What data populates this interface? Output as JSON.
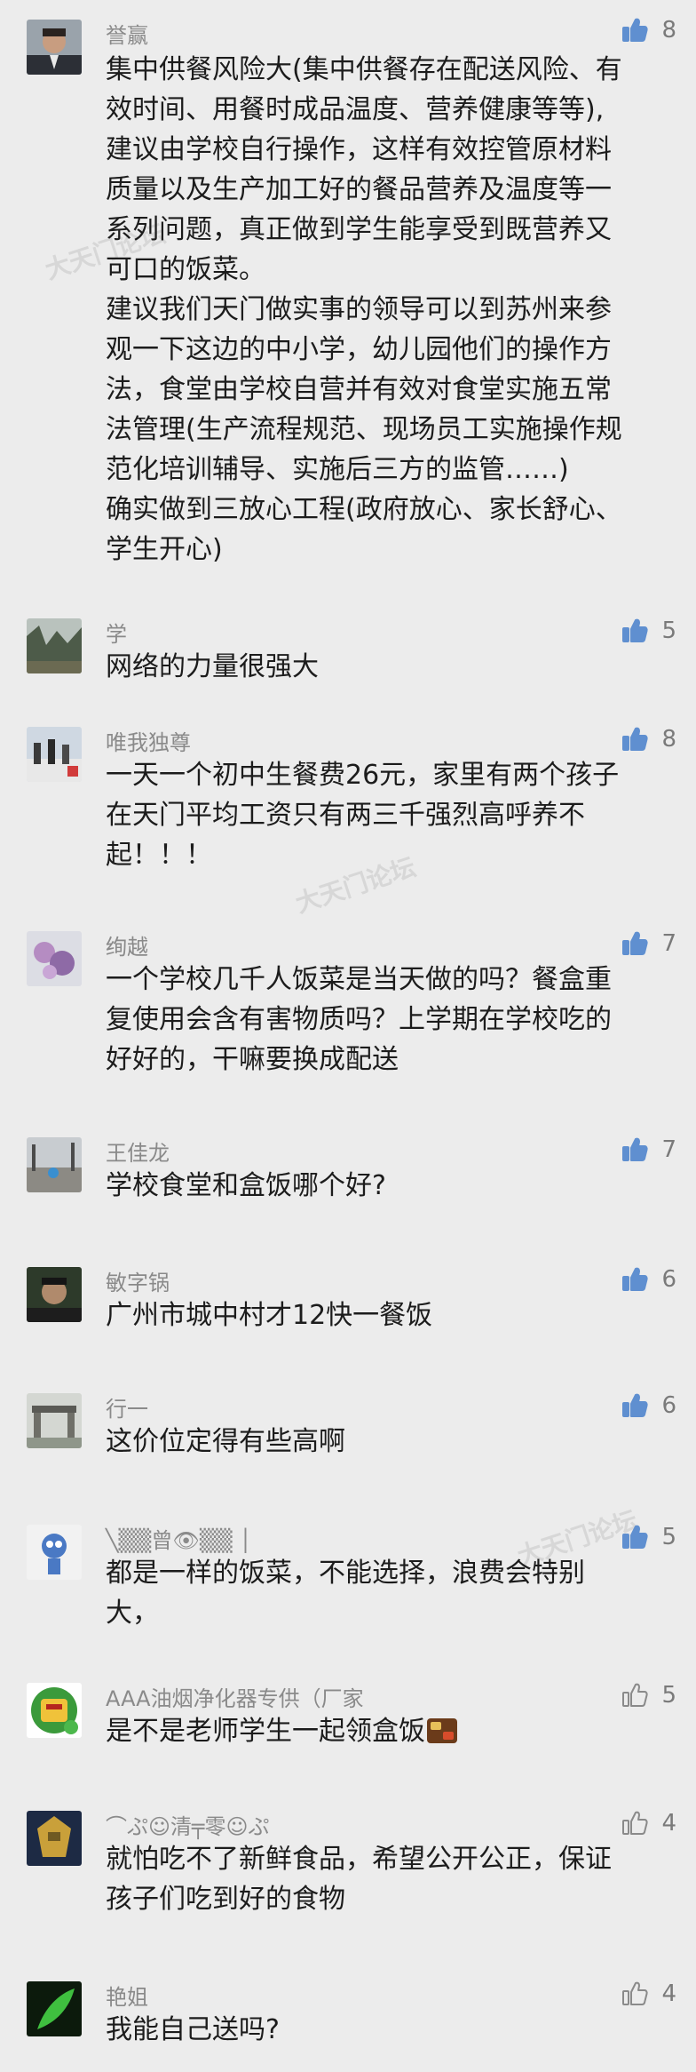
{
  "watermark": "大天门论坛",
  "comments": [
    {
      "user": "誉赢",
      "likes": "8",
      "liked": true,
      "lines": [
        "集中供餐风险大(集中供餐存在配送风险、有",
        "效时间、用餐时成品温度、营养健康等等),",
        "建议由学校自行操作，这样有效控管原材料",
        "质量以及生产加工好的餐品营养及温度等一",
        "系列问题，真正做到学生能享受到既营养又",
        "可口的饭菜。",
        "建议我们天门做实事的领导可以到苏州来参",
        "观一下这边的中小学，幼儿园他们的操作方",
        "法，食堂由学校自营并有效对食堂实施五常",
        "法管理(生产流程规范、现场员工实施操作规",
        "范化培训辅导、实施后三方的监管……)",
        "确实做到三放心工程(政府放心、家长舒心、",
        "学生开心)"
      ]
    },
    {
      "user": "学",
      "likes": "5",
      "liked": true,
      "lines": [
        "网络的力量很强大"
      ]
    },
    {
      "user": "唯我独尊",
      "likes": "8",
      "liked": true,
      "lines": [
        "一天一个初中生餐费26元，家里有两个孩子",
        "在天门平均工资只有两三千强烈高呼养不",
        "起！！！"
      ]
    },
    {
      "user": "绚越",
      "likes": "7",
      "liked": true,
      "lines": [
        "一个学校几千人饭菜是当天做的吗？餐盒重",
        "复使用会含有害物质吗？上学期在学校吃的",
        "好好的，干嘛要换成配送"
      ]
    },
    {
      "user": "王佳龙",
      "likes": "7",
      "liked": true,
      "lines": [
        "学校食堂和盒饭哪个好?"
      ]
    },
    {
      "user": "敏字锅",
      "likes": "6",
      "liked": true,
      "lines": [
        "广州市城中村才12快一餐饭"
      ]
    },
    {
      "user": "行一",
      "likes": "6",
      "liked": true,
      "lines": [
        "这价位定得有些高啊"
      ]
    },
    {
      "user": "╲▒▒曾👁▒▒ │",
      "likes": "5",
      "liked": true,
      "lines": [
        "都是一样的饭菜，不能选择，浪费会特别",
        "大，"
      ]
    },
    {
      "user": "AAA油烟净化器专供（厂家",
      "likes": "5",
      "liked": false,
      "lines": [
        "是不是老师学生一起领盒饭"
      ],
      "emoji": "bento-box-emoji"
    },
    {
      "user": "⌒ぷ☺清╤零☺ぷ",
      "likes": "4",
      "liked": false,
      "lines": [
        "就怕吃不了新鲜食品，希望公开公正，保证",
        "孩子们吃到好的食物"
      ]
    },
    {
      "user": "艳姐",
      "likes": "4",
      "liked": false,
      "lines": [
        "我能自己送吗?"
      ]
    }
  ],
  "colors": {
    "background": "#ececec",
    "liked": "#5f8fd0",
    "unliked": "#8a8a8a"
  }
}
